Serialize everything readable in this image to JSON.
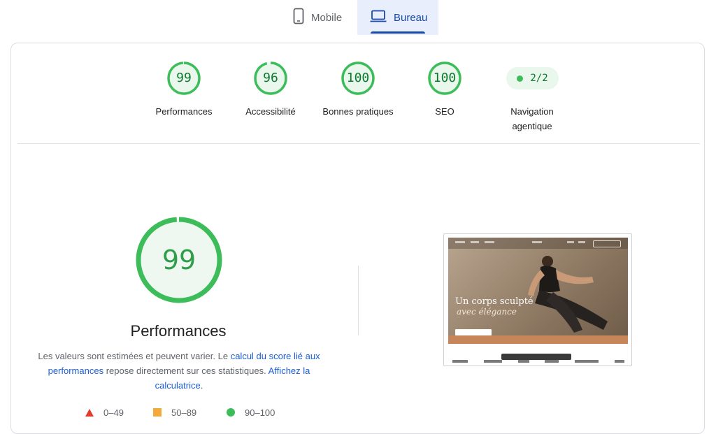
{
  "tabs": {
    "mobile": {
      "label": "Mobile",
      "icon": "smartphone-icon"
    },
    "desktop": {
      "label": "Bureau",
      "icon": "laptop-icon",
      "selected": true
    }
  },
  "summary": [
    {
      "score": "99",
      "label": "Performances",
      "fraction": 0.99
    },
    {
      "score": "96",
      "label": "Accessibilité",
      "fraction": 0.96
    },
    {
      "score": "100",
      "label": "Bonnes pratiques",
      "fraction": 1.0
    },
    {
      "score": "100",
      "label": "SEO",
      "fraction": 1.0
    }
  ],
  "agentic": {
    "value": "2/2",
    "label_line1": "Navigation",
    "label_line2": "agentique"
  },
  "performance": {
    "score": "99",
    "fraction": 0.99,
    "title": "Performances",
    "desc_part1": "Les valeurs sont estimées et peuvent varier. Le ",
    "desc_link1": "calcul du score lié aux performances",
    "desc_part2": " repose directement sur ces statistiques. ",
    "desc_link2": "Affichez la calculatrice",
    "desc_part3": "."
  },
  "legend": {
    "fail": "0–49",
    "average": "50–89",
    "pass": "90–100"
  },
  "thumbnail": {
    "headline": "Un corps sculpté",
    "subheadline": "avec élégance"
  },
  "colors": {
    "pass": "#3cbd5a",
    "pass_bg": "#e9f7ec",
    "average": "#f4a93c",
    "fail": "#e23b2e",
    "accent": "#1a4aa8",
    "link": "#1a5dd6"
  }
}
